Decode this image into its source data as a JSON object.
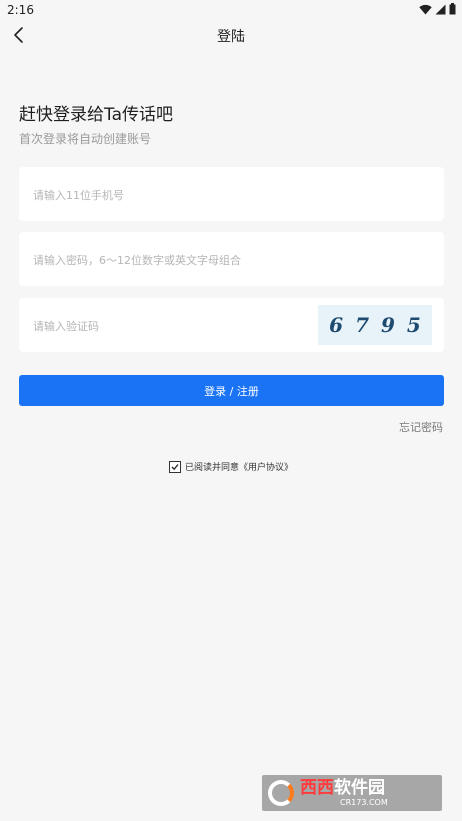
{
  "status_bar": {
    "time": "2:16",
    "icons": [
      "wifi-icon",
      "signal-icon",
      "battery-icon"
    ]
  },
  "app_bar": {
    "title": "登陆",
    "back_icon": "chevron-left-icon"
  },
  "headline": "赶快登录给Ta传话吧",
  "subline": "首次登录将自动创建账号",
  "form": {
    "phone": {
      "placeholder": "请输入11位手机号",
      "value": ""
    },
    "password": {
      "placeholder": "请输入密码，6～12位数字或英文字母组合",
      "value": ""
    },
    "captcha": {
      "placeholder": "请输入验证码",
      "value": "",
      "code": "6795"
    }
  },
  "login_button": "登录 / 注册",
  "forgot_password": "忘记密码",
  "agreement": {
    "checked": true,
    "text": "已阅读并同意《用户协议》"
  },
  "watermark": {
    "brand_red": "西西",
    "brand_white": "软件园",
    "url": "CR173.COM"
  },
  "colors": {
    "primary": "#1a73f5",
    "background": "#f6f6f7",
    "captcha_bg": "#e8f3f9"
  }
}
